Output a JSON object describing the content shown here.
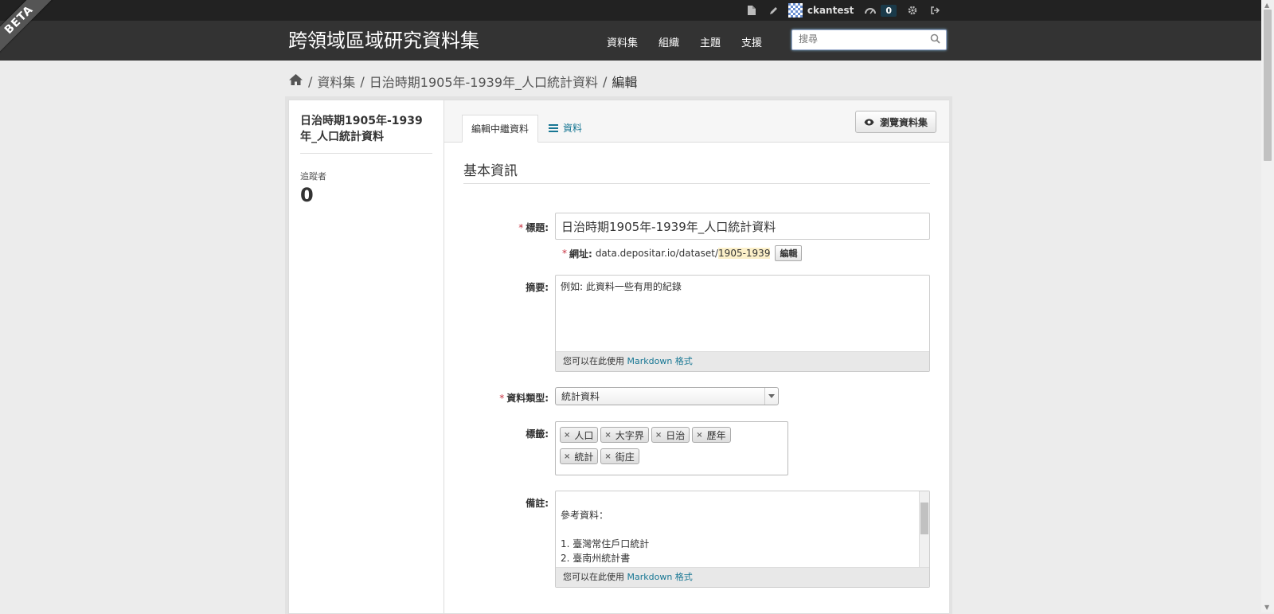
{
  "topbar": {
    "username": "ckantest",
    "dashboard_count": "0"
  },
  "ribbon": "BETA",
  "header": {
    "site_title": "跨領域區域研究資料集",
    "nav": [
      "資料集",
      "組織",
      "主題",
      "支援"
    ],
    "search_placeholder": "搜尋"
  },
  "breadcrumb": {
    "items": [
      "資料集",
      "日治時期1905年-1939年_人口統計資料"
    ],
    "active": "編輯"
  },
  "sidebar": {
    "dataset_title": "日治時期1905年-1939年_人口統計資料",
    "followers_label": "追蹤者",
    "followers_count": "0"
  },
  "tabs": {
    "edit_metadata": "編輯中繼資料",
    "resources": "資料"
  },
  "view_button": "瀏覽資料集",
  "form": {
    "section_title": "基本資訊",
    "title_label": "標題:",
    "title_value": "日治時期1905年-1939年_人口統計資料",
    "url_label": "網址:",
    "url_prefix": "data.depositar.io/dataset/",
    "url_slug": "1905-1939",
    "url_edit": "編輯",
    "description_label": "摘要:",
    "description_placeholder": "例如: 此資料一些有用的紀錄",
    "markdown_prefix": "您可以在此使用",
    "markdown_link": "Markdown 格式",
    "type_label": "資料類型:",
    "type_value": "統計資料",
    "tags_label": "標籤:",
    "tags": [
      "人口",
      "大字界",
      "日治",
      "歷年",
      "統計",
      "街庄"
    ],
    "notes_label": "備註:",
    "notes_lines": [
      "參考資料：",
      "",
      "1. 臺灣常住戶口統計",
      "2. 臺南州統計書"
    ]
  },
  "colors": {
    "link": "#187794",
    "required": "#c6303e",
    "masthead": "#333333"
  }
}
